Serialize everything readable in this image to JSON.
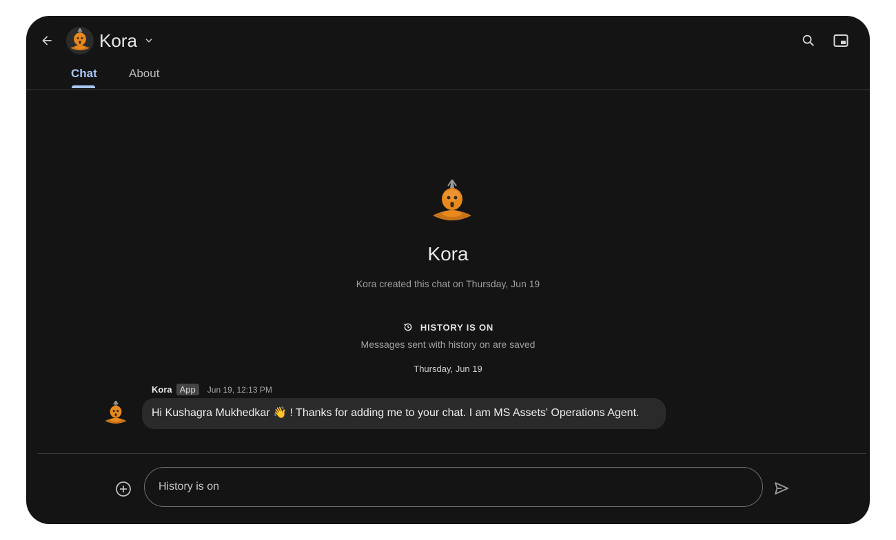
{
  "header": {
    "title": "Kora",
    "back_icon": "arrow-back-icon",
    "dropdown_icon": "chevron-down-icon",
    "search_icon": "search-icon",
    "pip_icon": "picture-in-picture-icon"
  },
  "tabs": [
    {
      "label": "Chat",
      "active": true
    },
    {
      "label": "About",
      "active": false
    }
  ],
  "intro": {
    "name": "Kora",
    "created_text": "Kora created this chat on Thursday, Jun 19",
    "history_title": "HISTORY IS ON",
    "history_icon": "history-icon",
    "history_subtitle": "Messages sent with history on are saved"
  },
  "date_divider": "Thursday, Jun 19",
  "messages": [
    {
      "sender": "Kora",
      "badge": "App",
      "time": "Jun 19, 12:13 PM",
      "text": "Hi Kushagra Mukhedkar 👋 ! Thanks for adding me to your chat. I am MS Assets' Operations Agent."
    }
  ],
  "composer": {
    "placeholder": "History is on",
    "add_icon": "add-circle-icon",
    "send_icon": "send-icon"
  },
  "colors": {
    "background": "#141414",
    "accent": "#a8c7fa",
    "bubble": "#2a2a2a",
    "avatar_orange": "#e8891e"
  }
}
